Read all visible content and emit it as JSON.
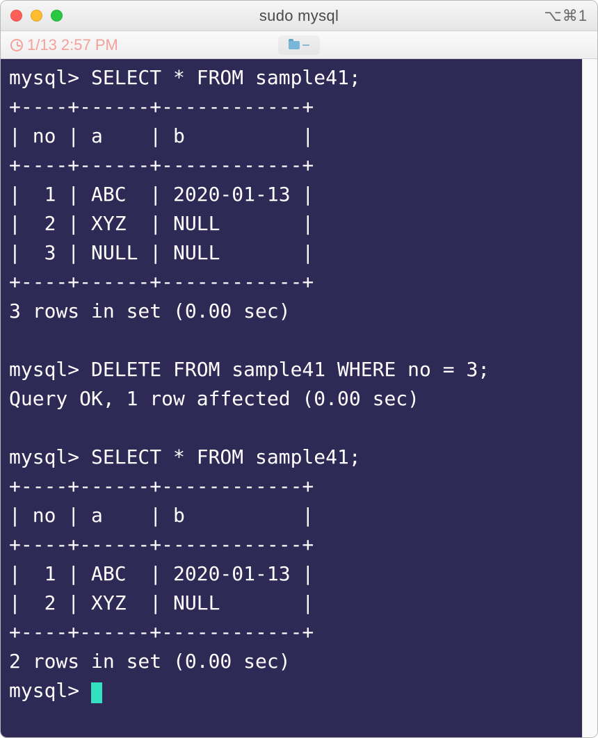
{
  "window": {
    "title": "sudo mysql",
    "shortcut": "⌥⌘1"
  },
  "toolbar": {
    "timestamp": "1/13 2:57 PM"
  },
  "terminal": {
    "prompt": "mysql>",
    "entries": [
      {
        "command": "SELECT * FROM sample41;",
        "table": {
          "border_top": "+----+------+------------+",
          "header": "| no | a    | b          |",
          "border_mid": "+----+------+------------+",
          "rows": [
            "|  1 | ABC  | 2020-01-13 |",
            "|  2 | XYZ  | NULL       |",
            "|  3 | NULL | NULL       |"
          ],
          "border_bot": "+----+------+------------+"
        },
        "status": "3 rows in set (0.00 sec)"
      },
      {
        "command": "DELETE FROM sample41 WHERE no = 3;",
        "status": "Query OK, 1 row affected (0.00 sec)"
      },
      {
        "command": "SELECT * FROM sample41;",
        "table": {
          "border_top": "+----+------+------------+",
          "header": "| no | a    | b          |",
          "border_mid": "+----+------+------------+",
          "rows": [
            "|  1 | ABC  | 2020-01-13 |",
            "|  2 | XYZ  | NULL       |"
          ],
          "border_bot": "+----+------+------------+"
        },
        "status": "2 rows in set (0.00 sec)"
      }
    ]
  },
  "table1_structured": {
    "columns": [
      "no",
      "a",
      "b"
    ],
    "rows": [
      {
        "no": 1,
        "a": "ABC",
        "b": "2020-01-13"
      },
      {
        "no": 2,
        "a": "XYZ",
        "b": null
      },
      {
        "no": 3,
        "a": null,
        "b": null
      }
    ]
  },
  "table2_structured": {
    "columns": [
      "no",
      "a",
      "b"
    ],
    "rows": [
      {
        "no": 1,
        "a": "ABC",
        "b": "2020-01-13"
      },
      {
        "no": 2,
        "a": "XYZ",
        "b": null
      }
    ]
  }
}
